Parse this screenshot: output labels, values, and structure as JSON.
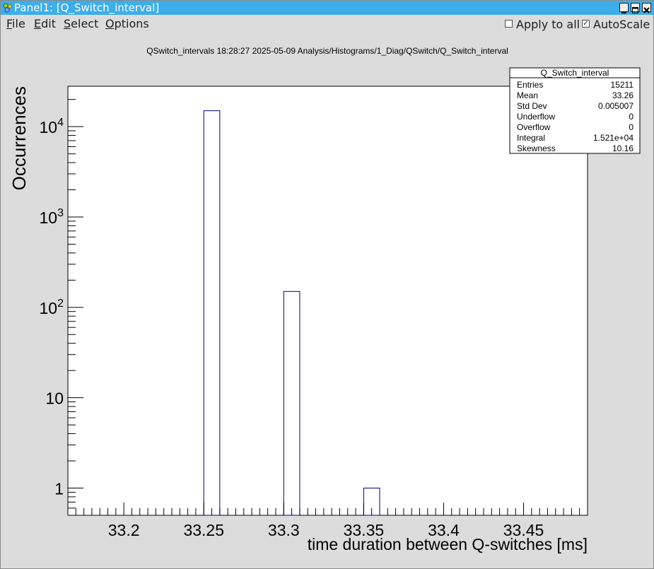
{
  "window": {
    "title": "Panel1: [Q_Switch_interval]",
    "minimize_glyph": "_",
    "maximize_glyph": "□",
    "close_glyph": "×"
  },
  "menu": {
    "file": "File",
    "edit": "Edit",
    "select": "Select",
    "options": "Options",
    "apply_to_all": "Apply to all",
    "apply_to_all_checked": false,
    "autoscale": "AutoScale",
    "autoscale_checked": true
  },
  "plot": {
    "title": "QSwitch_intervals  18:28:27  2025-05-09  Analysis/Histograms/1_Diag/QSwitch/Q_Switch_interval"
  },
  "stats": {
    "name": "Q_Switch_interval",
    "rows": [
      {
        "label": "Entries",
        "value": "15211"
      },
      {
        "label": "Mean",
        "value": "33.26"
      },
      {
        "label": "Std Dev",
        "value": "0.005007"
      },
      {
        "label": "Underflow",
        "value": "0"
      },
      {
        "label": "Overflow",
        "value": "0"
      },
      {
        "label": "Integral",
        "value": "1.521e+04"
      },
      {
        "label": "Skewness",
        "value": "10.16"
      }
    ]
  },
  "colors": {
    "titlebar": "#3daee9",
    "histogram_line": "#000080",
    "frame_bg": "#ffffff",
    "canvas_bg": "#dcdcdc"
  },
  "chart_data": {
    "type": "bar",
    "xlabel": "time duration between Q-switches [ms]",
    "ylabel": "Occurrences",
    "xlim": [
      33.165,
      33.49
    ],
    "ylim": [
      0.5,
      28000
    ],
    "log_y": true,
    "grid": false,
    "legend": "none",
    "bin_width": 0.01,
    "bins": [
      {
        "x_low": 33.25,
        "x_high": 33.26,
        "value": 15000
      },
      {
        "x_low": 33.3,
        "x_high": 33.31,
        "value": 150
      },
      {
        "x_low": 33.35,
        "x_high": 33.36,
        "value": 1
      }
    ],
    "x_ticks": [
      {
        "value": 33.2,
        "label": "33.2"
      },
      {
        "value": 33.25,
        "label": "33.25"
      },
      {
        "value": 33.3,
        "label": "33.3"
      },
      {
        "value": 33.35,
        "label": "33.35"
      },
      {
        "value": 33.4,
        "label": "33.4"
      },
      {
        "value": 33.45,
        "label": "33.45"
      }
    ],
    "y_ticks": [
      {
        "value": 1,
        "label": "1"
      },
      {
        "value": 10,
        "label": "10"
      },
      {
        "value": 100,
        "base": "10",
        "exp": "2"
      },
      {
        "value": 1000,
        "base": "10",
        "exp": "3"
      },
      {
        "value": 10000,
        "base": "10",
        "exp": "4"
      }
    ]
  }
}
